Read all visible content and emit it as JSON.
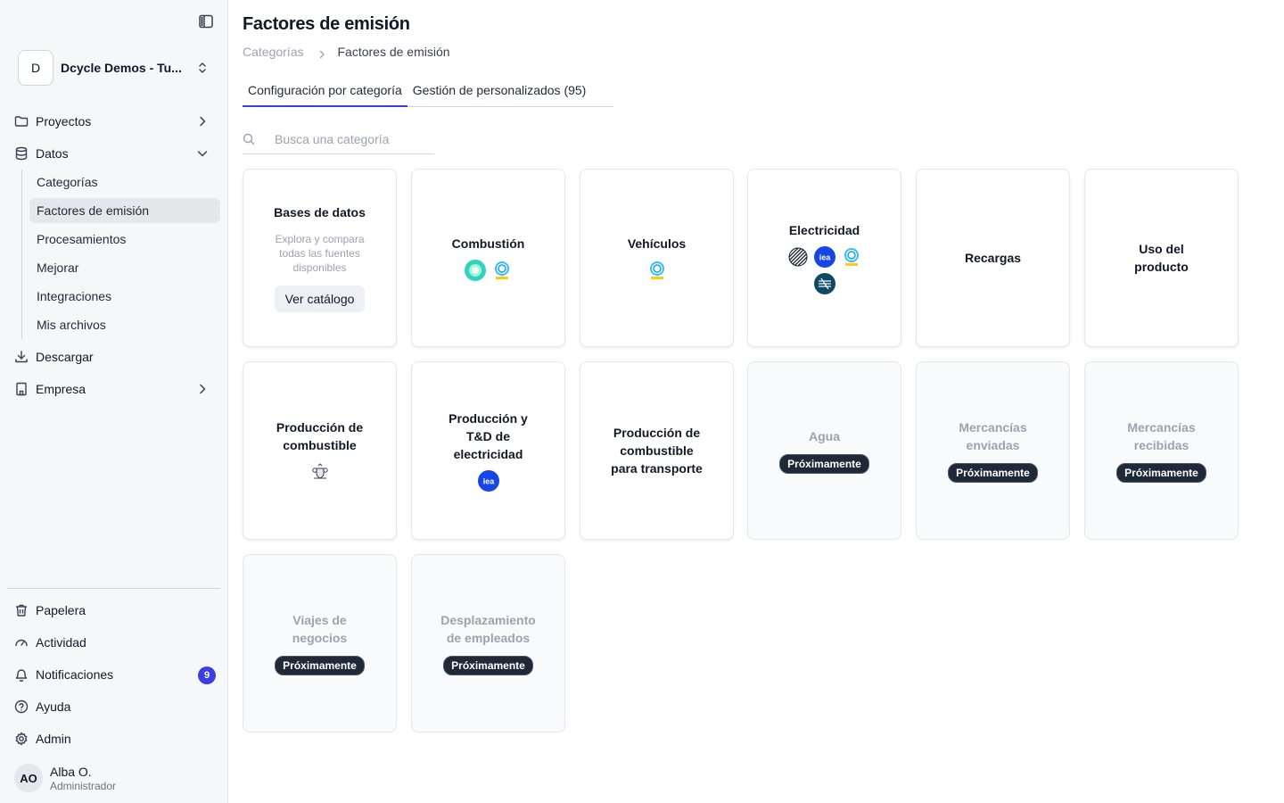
{
  "workspace": {
    "initial": "D",
    "name": "Dcycle Demos - Tu..."
  },
  "sidebar": {
    "items": [
      {
        "label": "Proyectos"
      },
      {
        "label": "Datos"
      },
      {
        "label": "Descargar"
      },
      {
        "label": "Empresa"
      }
    ],
    "sub_items": [
      {
        "label": "Categorías"
      },
      {
        "label": "Factores de emisión"
      },
      {
        "label": "Procesamientos"
      },
      {
        "label": "Mejorar"
      },
      {
        "label": "Integraciones"
      },
      {
        "label": "Mis archivos"
      }
    ],
    "bottom_items": [
      {
        "label": "Papelera"
      },
      {
        "label": "Actividad"
      },
      {
        "label": "Notificaciones",
        "badge": "9"
      },
      {
        "label": "Ayuda"
      },
      {
        "label": "Admin"
      }
    ]
  },
  "user": {
    "initials": "AO",
    "name": "Alba O.",
    "role": "Administrador"
  },
  "page": {
    "title": "Factores de emisión"
  },
  "breadcrumb": {
    "parent": "Categorías",
    "current": "Factores de emisión"
  },
  "tabs": [
    {
      "label": "Configuración por categoría"
    },
    {
      "label": "Gestión de personalizados (95)"
    }
  ],
  "search": {
    "placeholder": "Busca una categoría",
    "value": ""
  },
  "cards": [
    {
      "title": "Bases de datos",
      "description": "Explora y compara todas las fuentes disponibles",
      "button": "Ver catálogo"
    },
    {
      "title": "Combustión"
    },
    {
      "title": "Vehículos"
    },
    {
      "title": "Electricidad"
    },
    {
      "title": "Recargas"
    },
    {
      "title": "Uso del producto"
    },
    {
      "title": "Producción de combustible"
    },
    {
      "title": "Producción y T&D de electricidad"
    },
    {
      "title": "Producción de combustible para transporte"
    },
    {
      "title": "Agua",
      "status": "Próximamente"
    },
    {
      "title": "Mercancías enviadas",
      "status": "Próximamente"
    },
    {
      "title": "Mercancías recibidas",
      "status": "Próximamente"
    },
    {
      "title": "Viajes de negocios",
      "status": "Próximamente"
    },
    {
      "title": "Desplazamiento de empleados",
      "status": "Próximamente"
    }
  ],
  "logos": {
    "combustion": [
      "teal-circle-logo",
      "miteco-logo"
    ],
    "vehiculos": [
      "miteco-logo"
    ],
    "electricidad": [
      "striped-circle-logo",
      "iea-logo",
      "miteco-logo",
      "ree-logo"
    ],
    "produccion_combustible": [
      "uk-government-crest-logo"
    ],
    "produccion_electricidad": [
      "iea-logo"
    ]
  },
  "colors": {
    "accent": "#3b3fe0",
    "badge_bg": "#1f2937",
    "iea_blue": "#1646e6",
    "teal": "#2dd4bf",
    "ree_navy": "#0e4a66"
  }
}
